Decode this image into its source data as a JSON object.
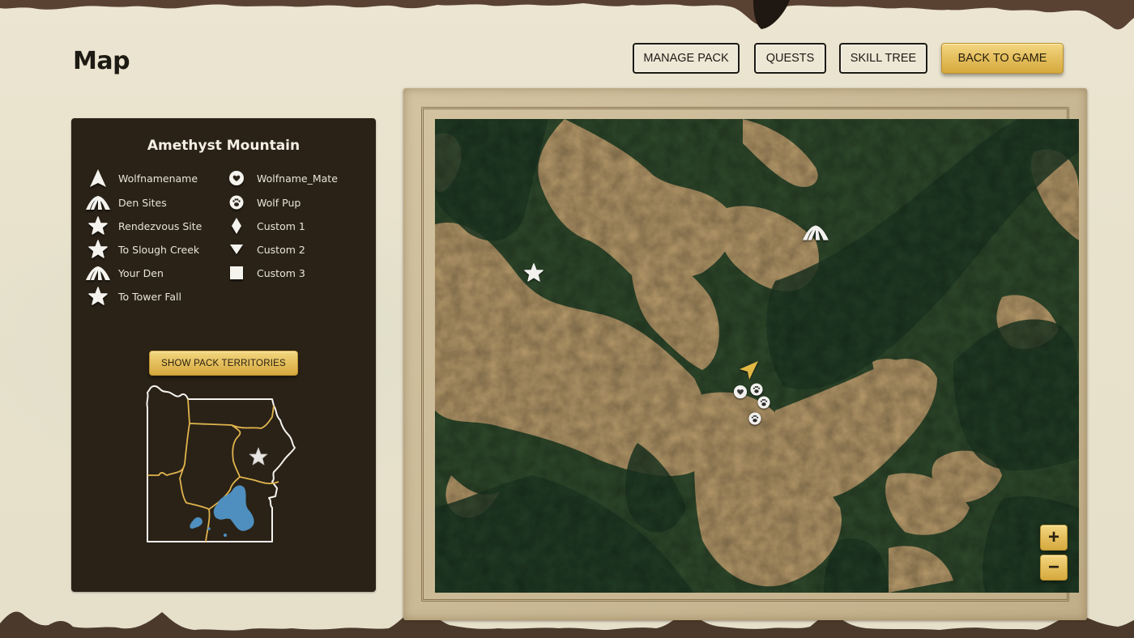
{
  "page": {
    "title": "Map"
  },
  "nav": {
    "buttons": [
      {
        "label": "MANAGE PACK"
      },
      {
        "label": "QUESTS"
      },
      {
        "label": "SKILL TREE"
      }
    ],
    "back_label": "BACK TO GAME"
  },
  "panel": {
    "region_name": "Amethyst Mountain",
    "legend_left": [
      {
        "label": "Wolfnamename",
        "icon": "player-arrow-icon"
      },
      {
        "label": "Den Sites",
        "icon": "den-icon"
      },
      {
        "label": "Rendezvous Site",
        "icon": "star-icon"
      },
      {
        "label": "To Slough Creek",
        "icon": "star-icon"
      },
      {
        "label": "Your Den",
        "icon": "den-icon"
      },
      {
        "label": "To Tower Fall",
        "icon": "star-icon"
      }
    ],
    "legend_right": [
      {
        "label": "Wolfname_Mate",
        "icon": "heart-ring-icon"
      },
      {
        "label": "Wolf Pup",
        "icon": "paw-icon"
      },
      {
        "label": "Custom 1",
        "icon": "diamond-icon"
      },
      {
        "label": "Custom 2",
        "icon": "triangle-down-icon"
      },
      {
        "label": "Custom 3",
        "icon": "square-icon"
      }
    ],
    "territories_button": "SHOW PACK TERRITORIES"
  },
  "map": {
    "zoom_in_label": "+",
    "zoom_out_label": "−",
    "markers": [
      "rendezvous-star",
      "den-site",
      "player-wolf",
      "mate",
      "pup",
      "pup",
      "pup"
    ]
  },
  "colors": {
    "gold": "#e6c160",
    "panel_bg": "#2a2217",
    "territory_line": "#e0b44e",
    "lake": "#4f8fbf"
  }
}
